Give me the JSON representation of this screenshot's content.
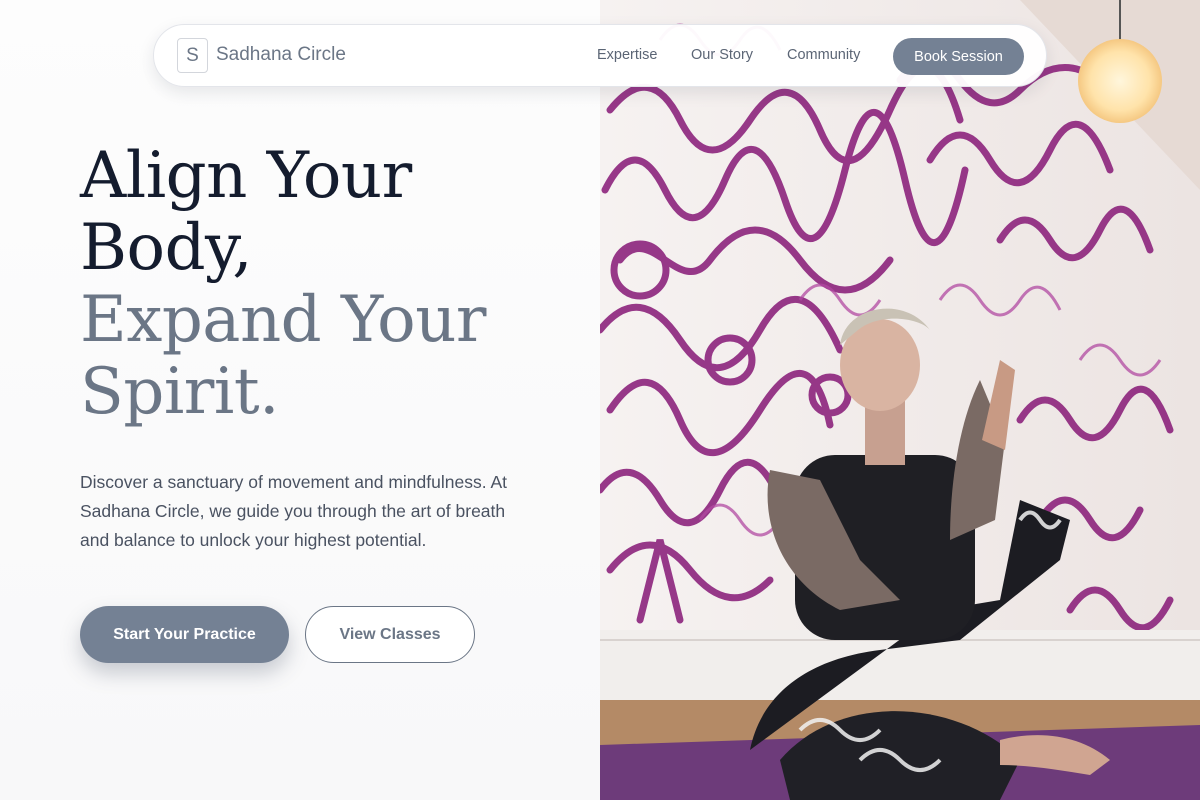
{
  "brand": {
    "logo_letter": "S",
    "name": "Sadhana Circle"
  },
  "nav": {
    "links": [
      "Expertise",
      "Our Story",
      "Community"
    ],
    "cta": "Book Session"
  },
  "hero": {
    "headline_line1": "Align Your",
    "headline_line2": "Body,",
    "headline_line3": "Expand Your",
    "headline_line4": "Spirit.",
    "description": "Discover a sanctuary of movement and mindfulness. At Sadhana Circle, we guide you through the art of breath and balance to unlock your highest potential.",
    "primary_button": "Start Your Practice",
    "secondary_button": "View Classes"
  },
  "colors": {
    "accent": "#748194",
    "heading_dark": "#141c2e",
    "heading_muted": "#6b7686",
    "graffiti": "#8a1f7a"
  }
}
